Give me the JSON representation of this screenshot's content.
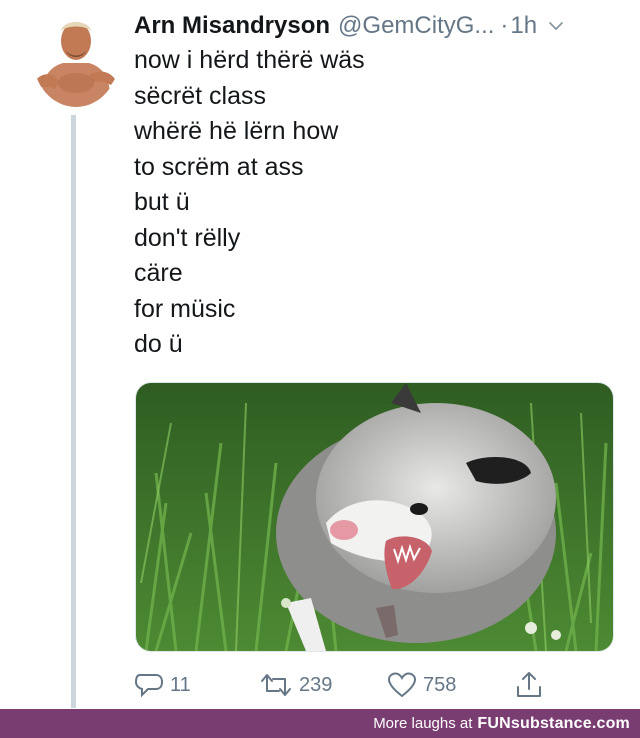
{
  "tweet": {
    "author_name": "Arn Misandryson",
    "handle": "@GemCityG...",
    "separator": "·",
    "time": "1h",
    "lines": [
      "now i hërd thërë wäs",
      "sëcrët class",
      "whërë hë lërn how",
      "to scrëm at ass",
      "but ü",
      "don't rëlly",
      "cäre",
      "for müsic",
      "do ü"
    ],
    "media_description_icon": "opossum-photo",
    "counts": {
      "replies": "11",
      "retweets": "239",
      "likes": "758"
    }
  },
  "footer": {
    "text": "More laughs at",
    "brand": "FUNsubstance.com"
  },
  "colors": {
    "footer_bg": "#7a3d72",
    "muted": "#657786",
    "thread_line": "#ccd6dd"
  }
}
